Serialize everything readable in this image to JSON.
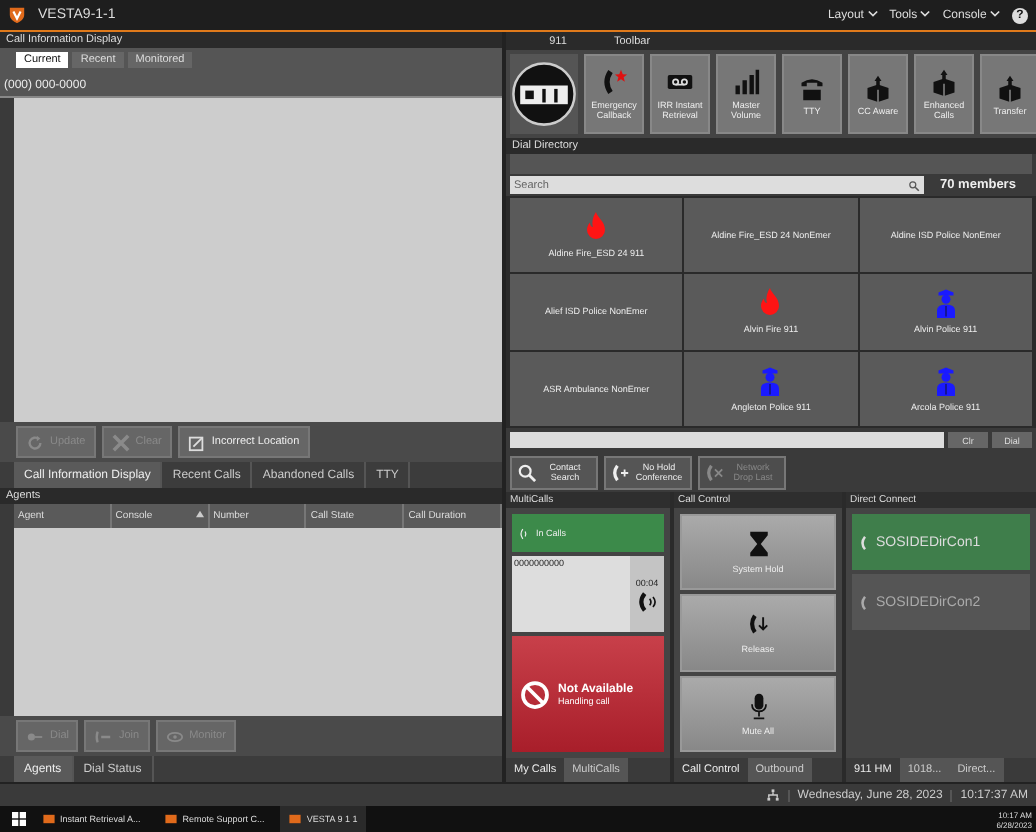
{
  "window": {
    "title": "VESTA9-1-1",
    "menus": [
      "Layout",
      "Tools",
      "Console"
    ],
    "help": "?"
  },
  "call_info": {
    "title": "Call Information Display",
    "tabs": [
      {
        "label": "Current",
        "selected": true
      },
      {
        "label": "Recent",
        "selected": false
      },
      {
        "label": "Monitored",
        "selected": false
      }
    ],
    "phone": "(000) 000-0000",
    "buttons": [
      {
        "label": "Update",
        "kind": "update",
        "disabled": true
      },
      {
        "label": "Clear",
        "kind": "clear",
        "disabled": true
      },
      {
        "label": "Incorrect Location",
        "kind": "location",
        "disabled": false
      }
    ],
    "bottom_tabs": [
      {
        "label": "Call Information Display",
        "selected": true
      },
      {
        "label": "Recent Calls",
        "selected": false
      },
      {
        "label": "Abandoned Calls",
        "selected": false
      },
      {
        "label": "TTY",
        "selected": false
      }
    ]
  },
  "agents": {
    "title": "Agents",
    "columns": [
      "Agent",
      "Console",
      "Number",
      "Call State",
      "Call Duration"
    ],
    "buttons": [
      {
        "label": "Dial",
        "kind": "dial"
      },
      {
        "label": "Join",
        "kind": "join"
      },
      {
        "label": "Monitor",
        "kind": "monitor"
      }
    ],
    "tabs": [
      {
        "label": "Agents",
        "selected": true
      },
      {
        "label": "Dial Status",
        "selected": false
      }
    ]
  },
  "toolbar": {
    "label_911": "911",
    "title": "Toolbar",
    "items": [
      {
        "label": "Emergency Callback",
        "kind": "callback"
      },
      {
        "label": "IRR Instant Retrieval",
        "kind": "tape"
      },
      {
        "label": "Master Volume",
        "kind": "volume"
      },
      {
        "label": "TTY",
        "kind": "tty"
      },
      {
        "label": "CC Aware",
        "kind": "box"
      },
      {
        "label": "Enhanced Calls",
        "kind": "box"
      },
      {
        "label": "Transfer",
        "kind": "box"
      }
    ]
  },
  "directory": {
    "title": "Dial Directory",
    "search_placeholder": "Search",
    "members": "70 members",
    "entries": [
      {
        "name": "Aldine Fire_ESD 24 911",
        "kind": "fire"
      },
      {
        "name": "Aldine Fire_ESD 24 NonEmer",
        "kind": "none"
      },
      {
        "name": "Aldine ISD Police NonEmer",
        "kind": "none"
      },
      {
        "name": "Alief ISD Police NonEmer",
        "kind": "none"
      },
      {
        "name": "Alvin Fire 911",
        "kind": "fire"
      },
      {
        "name": "Alvin Police 911",
        "kind": "police"
      },
      {
        "name": "ASR Ambulance NonEmer",
        "kind": "none"
      },
      {
        "name": "Angleton Police 911",
        "kind": "police"
      },
      {
        "name": "Arcola Police 911",
        "kind": "police"
      }
    ],
    "field_buttons": [
      "Clr",
      "Dial"
    ],
    "actions": [
      {
        "label": "Contact Search",
        "kind": "search",
        "disabled": false
      },
      {
        "label": "No Hold Conference",
        "kind": "conference",
        "disabled": false
      },
      {
        "label": "Network Drop Last",
        "kind": "drop",
        "disabled": true
      }
    ]
  },
  "multicalls": {
    "title": "MultiCalls",
    "in_calls": "In Calls",
    "number": "0000000000",
    "timer": "00:04",
    "status": "Not Available",
    "status_detail": "Handling call",
    "tabs": [
      {
        "label": "My Calls",
        "selected": true
      },
      {
        "label": "MultiCalls",
        "selected": false
      }
    ]
  },
  "call_control": {
    "title": "Call Control",
    "buttons": [
      {
        "label": "System Hold",
        "kind": "hold"
      },
      {
        "label": "Release",
        "kind": "release"
      },
      {
        "label": "Mute All",
        "kind": "mute"
      }
    ],
    "tabs": [
      {
        "label": "Call Control",
        "selected": true
      },
      {
        "label": "Outbound",
        "selected": false
      }
    ]
  },
  "direct_connect": {
    "title": "Direct Connect",
    "lines": [
      {
        "label": "SOSIDEDirCon1",
        "active": true
      },
      {
        "label": "SOSIDEDirCon2",
        "active": false
      }
    ],
    "tabs": [
      {
        "label": "911 HM",
        "selected": true
      },
      {
        "label": "1018...",
        "selected": false
      },
      {
        "label": "Direct...",
        "selected": false
      }
    ]
  },
  "status_bar": {
    "date": "Wednesday, June 28, 2023",
    "time": "10:17:37 AM"
  },
  "taskbar": {
    "apps": [
      "Instant Retrieval A...",
      "Remote Support C...",
      "VESTA 9 1 1"
    ],
    "time": "10:17 AM",
    "date": "6/28/2023"
  }
}
